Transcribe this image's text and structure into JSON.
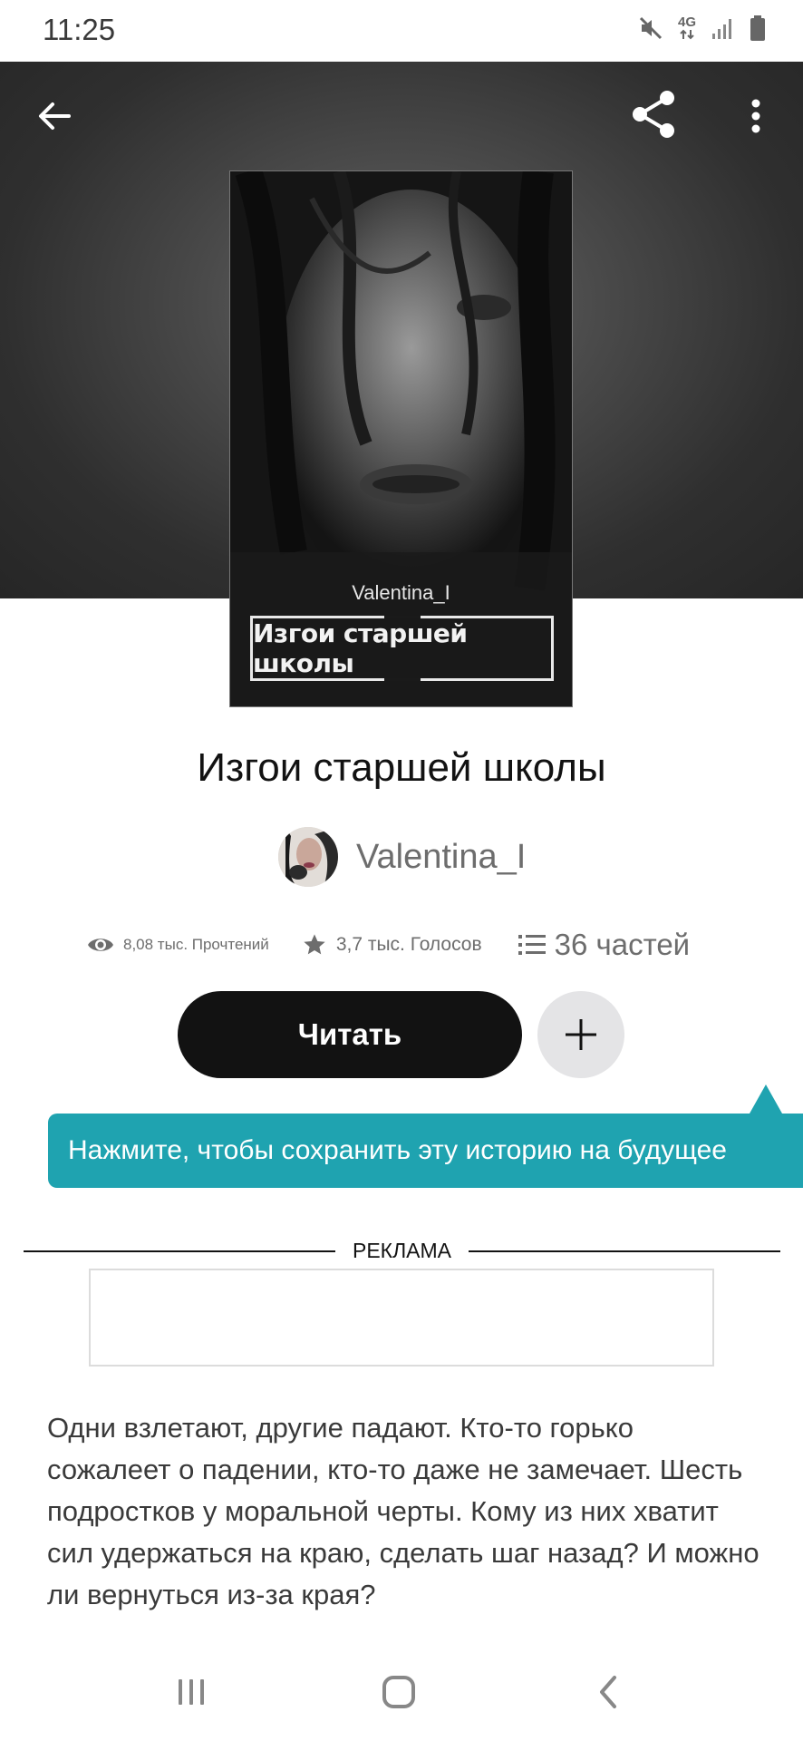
{
  "status_bar": {
    "time": "11:25",
    "network": "4G",
    "icons": [
      "mute-icon",
      "network-4g-icon",
      "signal-icon",
      "battery-icon"
    ]
  },
  "header": {
    "icons": [
      "arrow-left-icon",
      "share-icon",
      "more-vertical-icon"
    ]
  },
  "cover": {
    "author": "Valentina_I",
    "title": "Изгои старшей школы"
  },
  "story": {
    "title": "Изгои старшей школы",
    "author": "Valentina_I",
    "stats": {
      "reads": "8,08 тыс. Прочтений",
      "votes": "3,7 тыс. Голосов",
      "parts": "36 частей"
    },
    "read_button": "Читать",
    "description": "Одни взлетают, другие падают. Кто-то горько сожалеет о падении, кто-то даже не замечает. Шесть подростков у моральной черты. Кому из них хватит сил удержаться на краю, сделать шаг назад? И можно ли вернуться из-за края?"
  },
  "tooltip": {
    "text": "Нажмите, чтобы сохранить эту историю на будущее"
  },
  "ad": {
    "label": "РЕКЛАМА"
  },
  "colors": {
    "accent": "#1fa3b0",
    "primary_button": "#121212",
    "secondary_button": "#e4e4e6",
    "muted_text": "#6d6d6d"
  },
  "nav_bar": {
    "icons": [
      "recent-apps-icon",
      "home-icon",
      "back-icon"
    ]
  }
}
